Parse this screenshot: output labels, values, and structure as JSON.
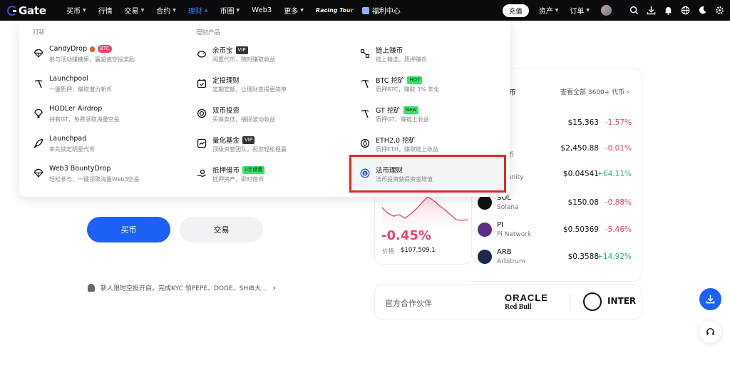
{
  "header": {
    "logo_text": "Gate",
    "nav": [
      {
        "label": "买币",
        "caret": true
      },
      {
        "label": "行情",
        "caret": false
      },
      {
        "label": "交易",
        "caret": true
      },
      {
        "label": "合约",
        "caret": true
      },
      {
        "label": "理财",
        "caret": true,
        "active": true
      },
      {
        "label": "币圈",
        "caret": true
      },
      {
        "label": "Web3",
        "caret": false
      },
      {
        "label": "更多",
        "caret": true
      }
    ],
    "racing_label": "Racing Tour",
    "welfare_label": "福利中心",
    "deposit_label": "充值",
    "assets_label": "资产",
    "orders_label": "订单"
  },
  "dropdown": {
    "section_left": "打新",
    "section_mid": "理财产品",
    "left": [
      {
        "title": "CandyDrop",
        "tag": "BTC",
        "desc": "参与活动赚糖果，赢超值空投奖励"
      },
      {
        "title": "Launchpool",
        "desc": "一键质押，赚取潜力新币"
      },
      {
        "title": "HODLer Airdrop",
        "desc": "持有GT，免费领取海量空投"
      },
      {
        "title": "Launchpad",
        "desc": "率先锁定明星代币"
      },
      {
        "title": "Web3 BountyDrop",
        "desc": "轻松参与，一键领取海量Web3空投"
      }
    ],
    "mid": [
      {
        "title": "余币宝",
        "tag": "VIP",
        "desc": "闲置代币，随时赚取收益"
      },
      {
        "title": "定投理财",
        "desc": "定期定额，让理财变得更简单"
      },
      {
        "title": "双币投资",
        "desc": "买高卖低，捕捉波动收益"
      },
      {
        "title": "量化基金",
        "tag": "VIP",
        "desc": "顶级资管团队，祝您轻松稳赢"
      },
      {
        "title": "抵押借币",
        "tag": "0手续费",
        "desc": "抵押资产，即时借币"
      }
    ],
    "right": [
      {
        "title": "链上赚币",
        "desc": "链上精选，质押赚币"
      },
      {
        "title": "BTC 挖矿",
        "tag": "HOT",
        "desc": "质押BTC，赚取 3% 年化"
      },
      {
        "title": "GT 挖矿",
        "tag": "New",
        "desc": "质押GT，赚链上收益"
      },
      {
        "title": "ETH2.0 挖矿",
        "desc": "质押ETH，赚取链上收益"
      },
      {
        "title": "法币理财",
        "desc": "法币投资获得资金增值"
      }
    ]
  },
  "hero": {
    "buy_label": "买币",
    "trade_label": "交易",
    "notice": "新人限时空投开启，完成KYC 领PEPE、DOGE、SHIB大..."
  },
  "market": {
    "heading_fragment": "币",
    "view_all": "查看全部 3600+ 代币",
    "rows": [
      {
        "symbol": "",
        "name": "",
        "price": "$15.363",
        "change": "-1.57%",
        "dir": "down",
        "color": "#ffffff"
      },
      {
        "symbol": "I",
        "name": "币",
        "price": "$2,450.88",
        "change": "-0.01%",
        "dir": "down",
        "color": "#ffffff"
      },
      {
        "symbol": "",
        "name": "anity",
        "price": "$0.04541",
        "change": "+64.11%",
        "dir": "up",
        "color": "#ffffff"
      },
      {
        "symbol": "SOL",
        "name": "Solana",
        "price": "$150.08",
        "change": "-0.88%",
        "dir": "down",
        "color": "#111111"
      },
      {
        "symbol": "PI",
        "name": "Pi Network",
        "price": "$0.50369",
        "change": "-5.46%",
        "dir": "down",
        "color": "#5b2f86"
      },
      {
        "symbol": "ARB",
        "name": "Arbitrum",
        "price": "$0.3588",
        "change": "+14.92%",
        "dir": "up",
        "color": "#1b2a4a"
      }
    ]
  },
  "chart_card": {
    "change": "-0.45%",
    "price_label": "价格",
    "price": "$107,509.1"
  },
  "partners": {
    "label": "官方合作伙伴",
    "oracle": "ORACLE",
    "redbull": "Red Bull",
    "inter": "INTER"
  }
}
